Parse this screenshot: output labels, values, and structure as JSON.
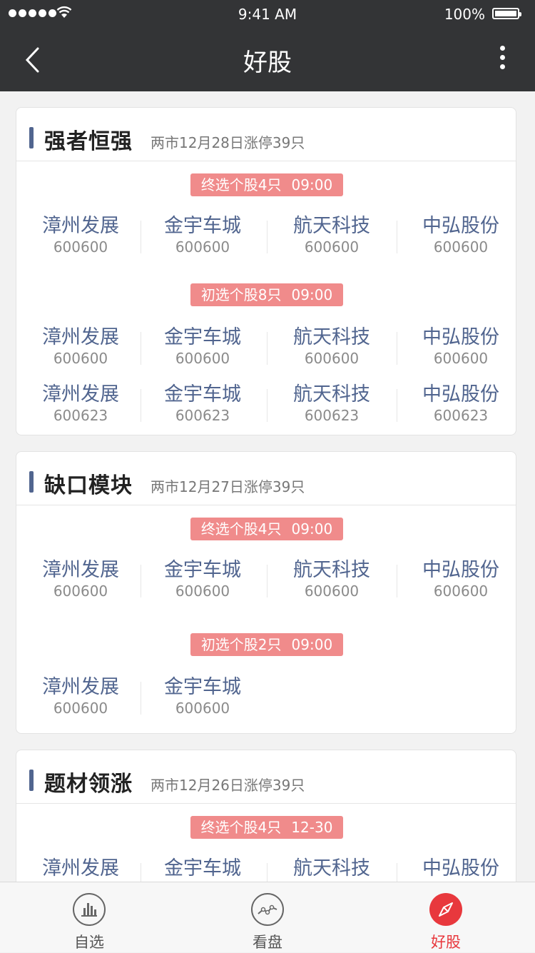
{
  "status_bar": {
    "time": "9:41 AM",
    "battery": "100%"
  },
  "nav": {
    "title": "好股"
  },
  "colors": {
    "accent": "#e8383d",
    "stock_name": "#51658f",
    "tag_bg": "#f08b8b",
    "header_bg": "#333436"
  },
  "cards": [
    {
      "title": "强者恒强",
      "subtitle": "两市12月28日涨停39只",
      "groups": [
        {
          "tag": "终选个股4只",
          "time": "09:00",
          "rows": [
            [
              {
                "name": "漳州发展",
                "code": "600600"
              },
              {
                "name": "金宇车城",
                "code": "600600"
              },
              {
                "name": "航天科技",
                "code": "600600"
              },
              {
                "name": "中弘股份",
                "code": "600600"
              }
            ]
          ]
        },
        {
          "tag": "初选个股8只",
          "time": "09:00",
          "rows": [
            [
              {
                "name": "漳州发展",
                "code": "600600"
              },
              {
                "name": "金宇车城",
                "code": "600600"
              },
              {
                "name": "航天科技",
                "code": "600600"
              },
              {
                "name": "中弘股份",
                "code": "600600"
              }
            ],
            [
              {
                "name": "漳州发展",
                "code": "600623"
              },
              {
                "name": "金宇车城",
                "code": "600623"
              },
              {
                "name": "航天科技",
                "code": "600623"
              },
              {
                "name": "中弘股份",
                "code": "600623"
              }
            ]
          ]
        }
      ]
    },
    {
      "title": "缺口模块",
      "subtitle": "两市12月27日涨停39只",
      "groups": [
        {
          "tag": "终选个股4只",
          "time": "09:00",
          "rows": [
            [
              {
                "name": "漳州发展",
                "code": "600600"
              },
              {
                "name": "金宇车城",
                "code": "600600"
              },
              {
                "name": "航天科技",
                "code": "600600"
              },
              {
                "name": "中弘股份",
                "code": "600600"
              }
            ]
          ]
        },
        {
          "tag": "初选个股2只",
          "time": "09:00",
          "rows": [
            [
              {
                "name": "漳州发展",
                "code": "600600"
              },
              {
                "name": "金宇车城",
                "code": "600600"
              }
            ]
          ]
        }
      ]
    },
    {
      "title": "题材领涨",
      "subtitle": "两市12月26日涨停39只",
      "groups": [
        {
          "tag": "终选个股4只",
          "time": "12-30",
          "rows": [
            [
              {
                "name": "漳州发展",
                "code": ""
              },
              {
                "name": "金宇车城",
                "code": ""
              },
              {
                "name": "航天科技",
                "code": ""
              },
              {
                "name": "中弘股份",
                "code": ""
              }
            ]
          ]
        }
      ]
    }
  ],
  "tabbar": {
    "items": [
      {
        "label": "自选",
        "icon": "bar-chart-icon",
        "active": false
      },
      {
        "label": "看盘",
        "icon": "line-chart-icon",
        "active": false
      },
      {
        "label": "好股",
        "icon": "compass-icon",
        "active": true
      }
    ]
  }
}
